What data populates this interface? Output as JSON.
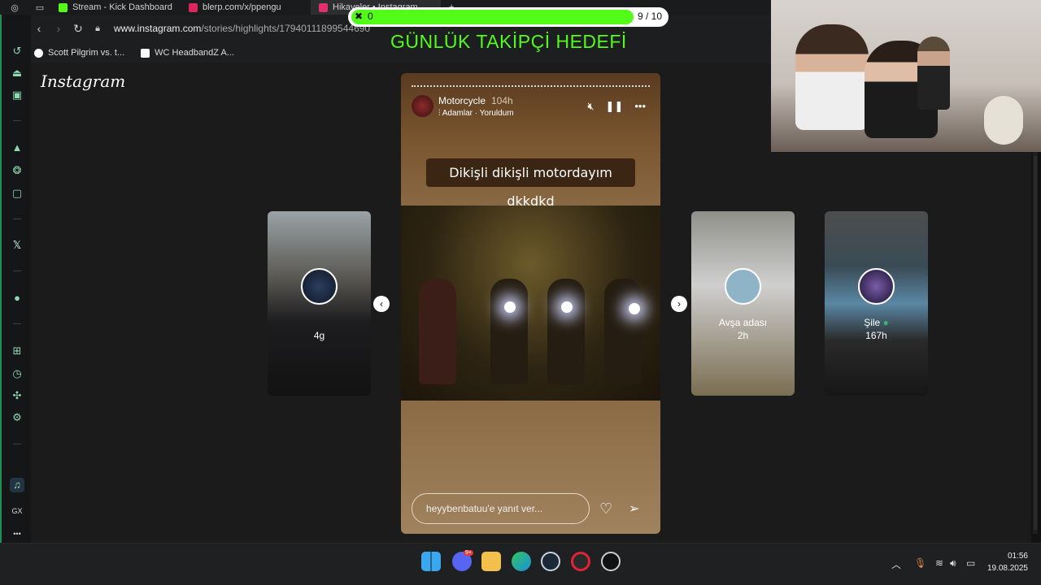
{
  "browser": {
    "tabs": [
      {
        "label": "Stream - Kick Dashboard",
        "color": "#53fc18"
      },
      {
        "label": "blerp.com/x/ppengu",
        "color": "#e0245e"
      },
      {
        "label": "Hikayeler • Instagram",
        "color": "#e1306c"
      }
    ],
    "new_tab": "+",
    "url_domain": "www.instagram.com",
    "url_path": "/stories/highlights/17940111899544690",
    "bookmarks": [
      {
        "label": "Scott Pilgrim vs. t..."
      },
      {
        "label": "WC HeadbandZ A..."
      }
    ]
  },
  "sidebar": {
    "items": [
      "history-icon",
      "aria-icon",
      "messenger-icon",
      "dash",
      "arc-icon",
      "chatgpt-icon",
      "twitch-icon",
      "dash",
      "x-icon",
      "dash",
      "player-icon",
      "dash",
      "workspaces-icon",
      "clock-icon",
      "extensions-icon",
      "settings-icon",
      "dash",
      "music-icon",
      "gx-label",
      "more-icon"
    ],
    "gx_label": "GX",
    "more_label": "•••"
  },
  "instagram": {
    "logo": "Instagram",
    "story": {
      "username": "Motorcycle",
      "time": "104h",
      "music": "Adamlar · Yoruldum",
      "caption": "Dikişli dikişli motordayım dkkdkd",
      "reply_placeholder": "heyybenbatuu'e yanıt ver..."
    },
    "cards": [
      {
        "label": "4g",
        "sub": ""
      },
      {
        "label": "Avşa adası",
        "sub": "2h"
      },
      {
        "label": "Şile",
        "sub": "167h"
      }
    ]
  },
  "overlay": {
    "goal_current": "0",
    "goal_count": "9 / 10",
    "goal_fraction": 0.9,
    "goal_title": "GÜNLÜK TAKİPÇİ HEDEFİ",
    "accent": "#53fc18"
  },
  "taskbar": {
    "time": "01:56",
    "date": "19.08.2025",
    "discord_badge": "9+"
  }
}
